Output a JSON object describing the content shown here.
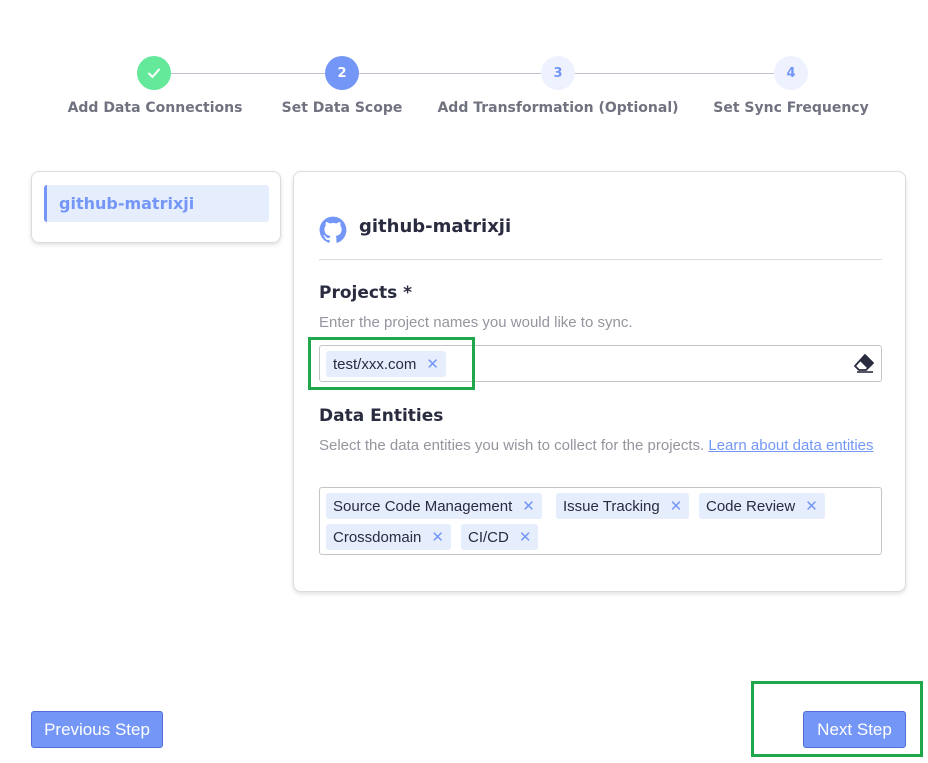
{
  "stepper": {
    "steps": [
      {
        "number": "",
        "label": "Add Data Connections",
        "state": "done"
      },
      {
        "number": "2",
        "label": "Set Data Scope",
        "state": "active"
      },
      {
        "number": "3",
        "label": "Add Transformation (Optional)",
        "state": "pending"
      },
      {
        "number": "4",
        "label": "Set Sync Frequency",
        "state": "pending"
      }
    ]
  },
  "sidebar": {
    "connection_label": "github-matrixji"
  },
  "form": {
    "title": "github-matrixji",
    "icon": "github-icon",
    "projects": {
      "title": "Projects *",
      "description": "Enter the project names you would like to sync.",
      "tags": [
        "test/xxx.com"
      ]
    },
    "entities": {
      "title": "Data Entities",
      "description": "Select the data entities you wish to collect for the projects.",
      "link_text": "Learn about data entities",
      "tags": [
        "Source Code Management",
        "Issue Tracking",
        "Code Review",
        "Crossdomain",
        "CI/CD"
      ]
    }
  },
  "buttons": {
    "previous": "Previous Step",
    "next": "Next Step"
  },
  "colors": {
    "accent": "#7497f7",
    "done": "#64e89a",
    "highlight": "#1fa84a"
  }
}
